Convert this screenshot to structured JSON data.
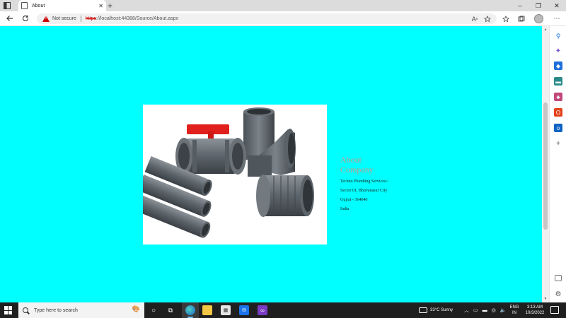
{
  "browser": {
    "tab_title": "About",
    "tab_close": "✕",
    "new_tab": "+",
    "security_label": "Not secure",
    "url_protocol": "https",
    "url_rest": "://localhost:44388/Source/About.aspx",
    "window_controls": [
      "–",
      "❐",
      "✕"
    ]
  },
  "page": {
    "background_color": "#00ffff",
    "heading_color": "#c29a8c",
    "heading_line1": "About",
    "heading_line2": "Company",
    "address_lines": [
      "Techno Plumbing Services>",
      "Sector 01, Bhuvanasur City",
      "Gujrat - 364040",
      "India"
    ],
    "image_icon": "pvc-pipes-fittings-photo"
  },
  "taskbar": {
    "search_placeholder": "Type here to search",
    "weather": "33°C  Sunny",
    "lang_line1": "ENG",
    "lang_line2": "IN",
    "time": "3:13 AM",
    "date": "10/3/2022"
  }
}
